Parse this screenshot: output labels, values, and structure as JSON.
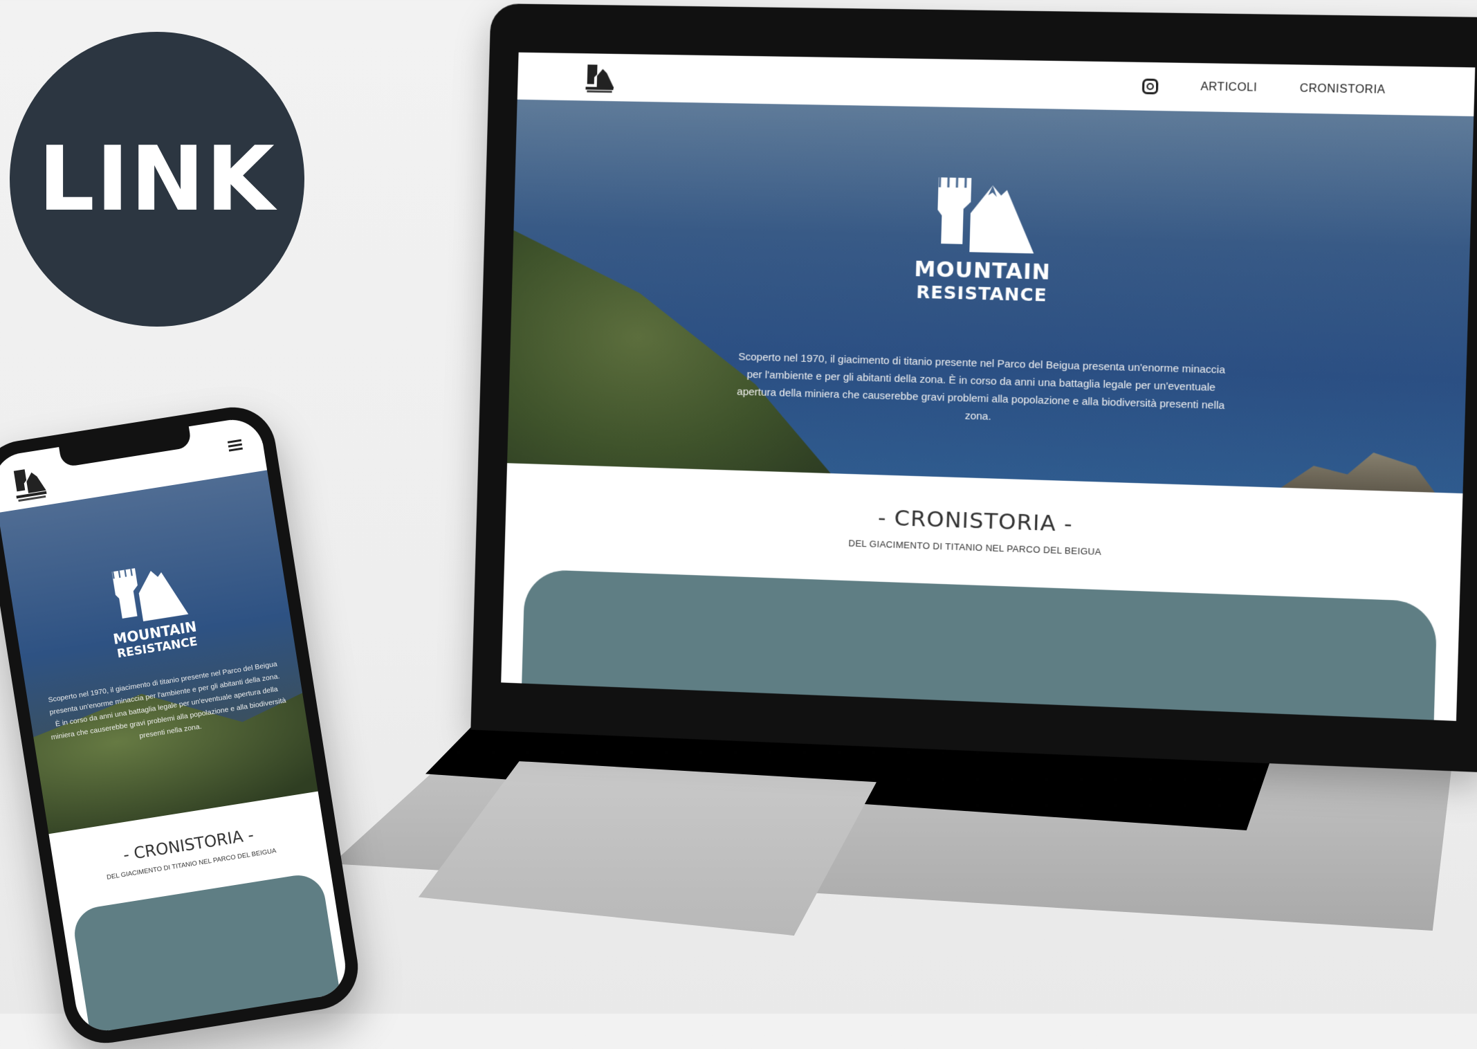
{
  "badge": {
    "label": "LINK"
  },
  "brand": {
    "line1": "MOUNTAIN",
    "line2": "RESISTANCE"
  },
  "nav": {
    "instagram_icon": "instagram-icon",
    "items": [
      "ARTICOLI",
      "CRONISTORIA"
    ]
  },
  "hero": {
    "text": "Scoperto nel 1970, il giacimento di titanio presente nel Parco del Beigua presenta un'enorme minaccia per l'ambiente e per gli abitanti della zona. È in corso da anni una battaglia legale per un'eventuale apertura della miniera che causerebbe gravi problemi alla popolazione e alla biodiversità presenti nella zona."
  },
  "section": {
    "title": "- CRONISTORIA -",
    "subtitle": "DEL GIACIMENTO DI TITANIO NEL PARCO DEL BEIGUA"
  },
  "phone": {
    "menu_icon": "hamburger-menu-icon"
  },
  "colors": {
    "badge_bg": "#2c3641",
    "teal": "#5f7e84",
    "sea": "#2b4f83"
  }
}
